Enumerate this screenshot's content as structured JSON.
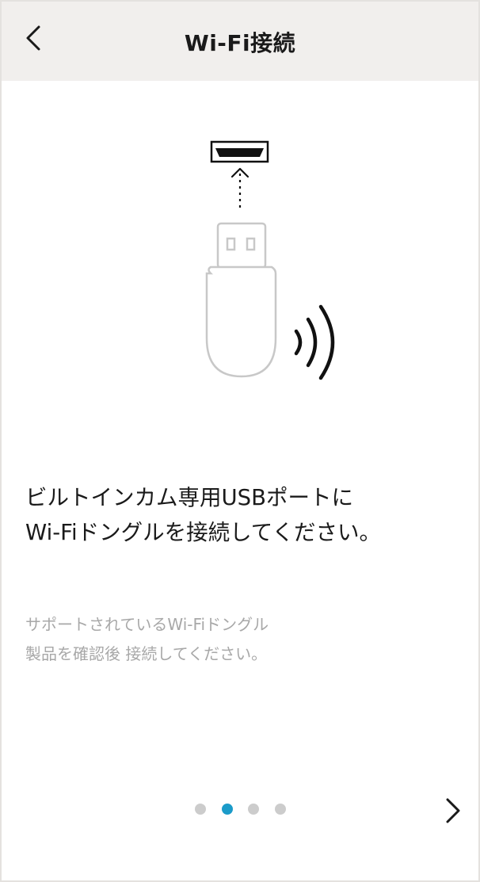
{
  "header": {
    "title": "Wi-Fi接続",
    "back_icon": "chevron-left-icon"
  },
  "illustration": {
    "description_icons": [
      "usb-port-icon",
      "insert-arrow-icon",
      "usb-dongle-icon",
      "wireless-signal-icon"
    ],
    "dongle_color": "#c8c8c8",
    "line_color": "#111111"
  },
  "instruction": {
    "line1": "ビルトインカム専用USBポートに",
    "line2": "Wi-Fiドングルを接続してください。"
  },
  "note": {
    "line1": "サポートされているWi-Fiドングル",
    "line2": "製品を確認後 接続してください。"
  },
  "pagination": {
    "total": 4,
    "current": 2,
    "active_color": "#1b9bc9",
    "inactive_color": "#cccccc"
  },
  "navigation": {
    "next_icon": "chevron-right-icon"
  }
}
